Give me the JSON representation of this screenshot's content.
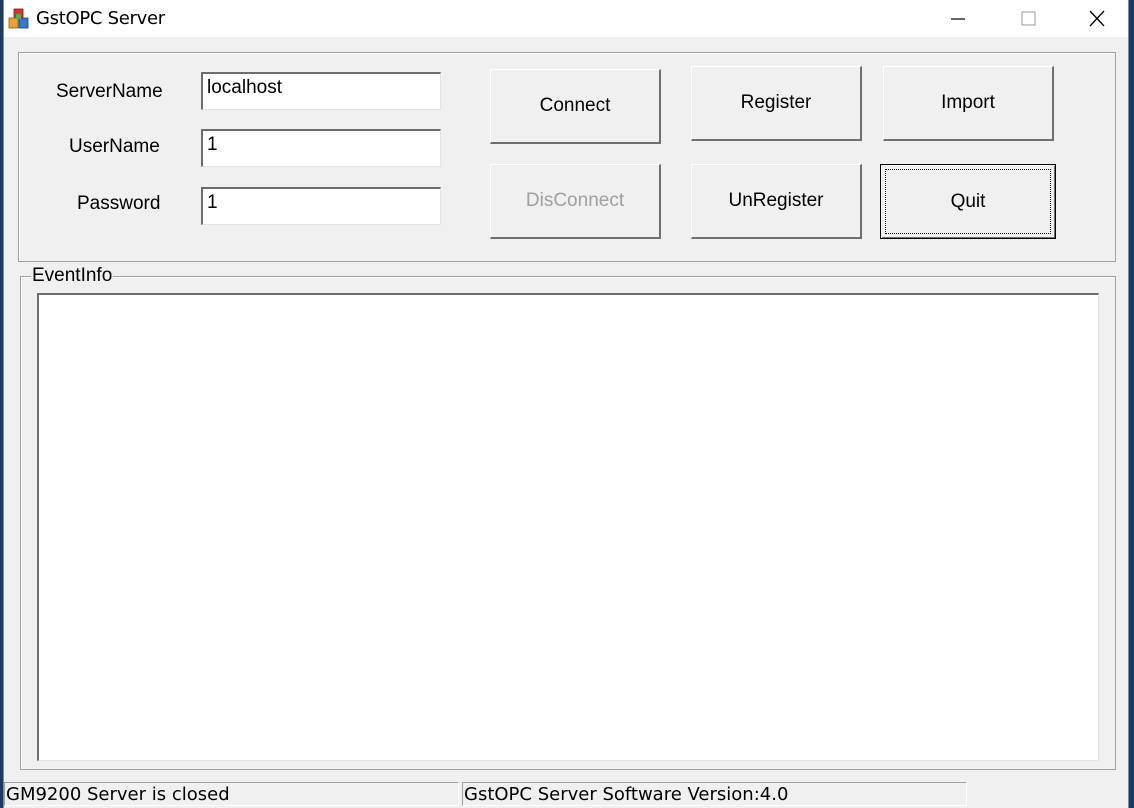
{
  "window": {
    "title": "GstOPC Server",
    "app_icon": "cubes-app-icon",
    "controls": [
      "minimize-icon",
      "maximize-icon",
      "close-icon"
    ]
  },
  "form": {
    "server_name": {
      "label": "ServerName",
      "value": "localhost"
    },
    "user_name": {
      "label": "UserName",
      "value": "1"
    },
    "password": {
      "label": "Password",
      "value": "1"
    }
  },
  "buttons": {
    "connect": "Connect",
    "disconnect": "DisConnect",
    "register": "Register",
    "unregister": "UnRegister",
    "import": "Import",
    "quit": "Quit"
  },
  "event_info": {
    "label": "EventInfo",
    "lines": []
  },
  "status_bar": {
    "left": "GM9200 Server is closed",
    "right": "GstOPC Server Software Version:4.0"
  },
  "colors": {
    "window_bg": "#f0f0f0",
    "disabled_text": "#a0a0a0"
  }
}
